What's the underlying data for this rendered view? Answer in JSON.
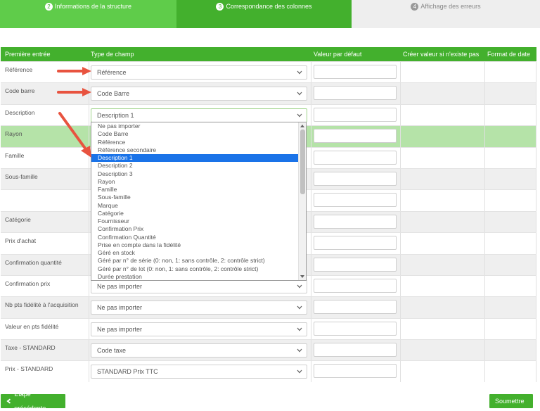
{
  "steps": [
    {
      "num": "2",
      "label": "Informations de la structure"
    },
    {
      "num": "3",
      "label": "Correspondance des colonnes"
    },
    {
      "num": "4",
      "label": "Affichage des erreurs"
    }
  ],
  "table": {
    "headers": {
      "first": "Première entrée",
      "type": "Type de champ",
      "default": "Valeur par défaut",
      "create": "Créer valeur si n'existe pas",
      "date": "Format de date"
    },
    "rows": [
      {
        "label": "Référence",
        "select": "Référence"
      },
      {
        "label": "Code barre",
        "select": "Code Barre"
      },
      {
        "label": "Description",
        "select": "Description 1"
      },
      {
        "label": "Rayon",
        "select": ""
      },
      {
        "label": "Famille",
        "select": ""
      },
      {
        "label": "Sous-famille",
        "select": ""
      },
      {
        "label": "",
        "select": ""
      },
      {
        "label": "Catégorie",
        "select": ""
      },
      {
        "label": "Prix d'achat",
        "select": ""
      },
      {
        "label": "Confirmation quantité",
        "select": ""
      },
      {
        "label": "Confirmation prix",
        "select": "Ne pas importer"
      },
      {
        "label": "Nb pts fidélité à l'acquisition",
        "select": "Ne pas importer"
      },
      {
        "label": "Valeur en pts fidélité",
        "select": "Ne pas importer"
      },
      {
        "label": "Taxe - STANDARD",
        "select": "Code taxe"
      },
      {
        "label": "Prix - STANDARD",
        "select": "STANDARD Prix TTC"
      }
    ]
  },
  "dropdown": {
    "options": [
      "Ne pas importer",
      "Code Barre",
      "Référence",
      "Référence secondaire",
      "Description 1",
      "Description 2",
      "Description 3",
      "Rayon",
      "Famille",
      "Sous-famille",
      "Marque",
      "Catégorie",
      "Fournisseur",
      "Confirmation Prix",
      "Confirmation Quantité",
      "Prise en compte dans la fidélité",
      "Géré en stock",
      "Géré par n° de série (0: non, 1: sans contrôle, 2: contrôle strict)",
      "Géré par n° de lot (0: non, 1: sans contrôle, 2: contrôle strict)",
      "Durée prestation"
    ],
    "selected_index": 4
  },
  "buttons": {
    "prev": "Etape précédente",
    "next": "Soumettre"
  },
  "colors": {
    "green": "#43b02d",
    "green_light": "#5fcc4a",
    "highlight_row": "#b5e3a8",
    "arrow": "#e8533f",
    "option_active": "#1a73e8"
  }
}
